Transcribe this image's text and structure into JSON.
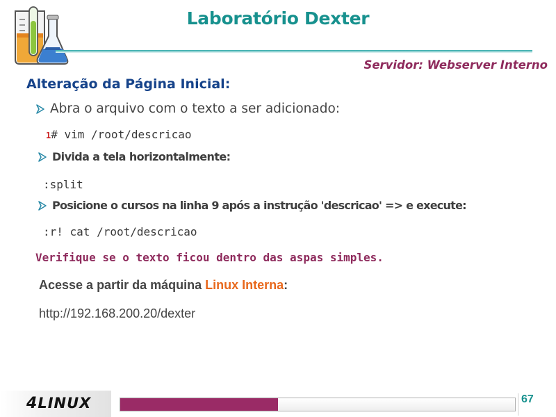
{
  "header": {
    "title": "Laboratório Dexter",
    "subtitle": "Servidor: Webserver Interno",
    "logo_icon": "lab-glassware-icon"
  },
  "content": {
    "heading": "Alteração da Página Inicial:",
    "bullet_icon": "arrow-bullet-icon",
    "steps": [
      {
        "text": "Abra o arquivo com o texto a ser adicionado:",
        "code_line_number": "1",
        "code": "# vim /root/descricao"
      },
      {
        "text": "Divida a tela horizontalmente:",
        "code": ":split"
      },
      {
        "text": "Posicione o cursos na linha 9 após a instrução 'descricao' => e execute:",
        "code": ":r! cat /root/descricao"
      }
    ],
    "warning": "Verifique se o texto ficou dentro das aspas simples.",
    "access_prefix": "Acesse a partir da máquina ",
    "access_highlight": "Linux Interna",
    "access_suffix": ":",
    "url": "http://192.168.200.20/dexter"
  },
  "footer": {
    "brand_prefix": "4",
    "brand_rest": "LINUX",
    "page_number": "67",
    "progress_fraction": 0.4
  },
  "colors": {
    "title": "#17918e",
    "subtitle": "#8e2a5c",
    "heading": "#16438a",
    "highlight": "#e8681c",
    "progress": "#9a2b66"
  }
}
